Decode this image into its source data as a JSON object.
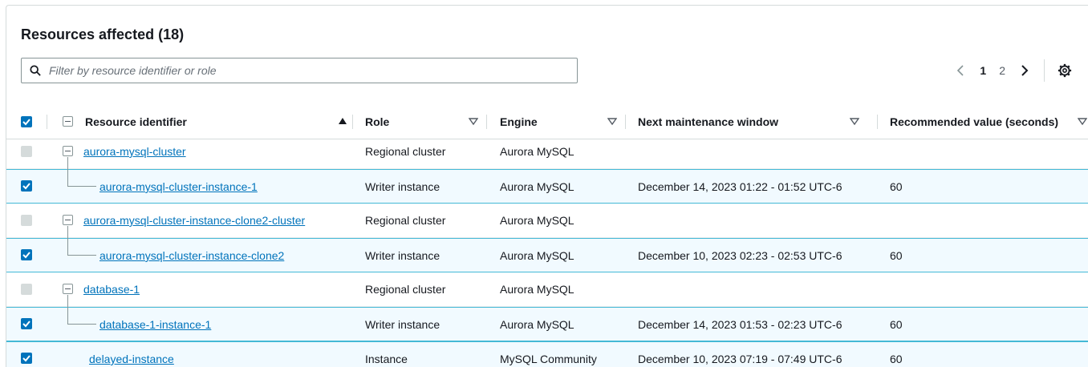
{
  "header": {
    "title": "Resources affected (18)"
  },
  "search": {
    "placeholder": "Filter by resource identifier or role",
    "value": ""
  },
  "pagination": {
    "pages": [
      "1",
      "2"
    ],
    "current_page": "1"
  },
  "columns": {
    "resource": "Resource identifier",
    "role": "Role",
    "engine": "Engine",
    "window": "Next maintenance window",
    "recommended": "Recommended value (seconds)"
  },
  "rows": [
    {
      "id": "aurora-mysql-cluster",
      "role": "Regional cluster",
      "engine": "Aurora MySQL",
      "window": "",
      "recommended": "",
      "checked": false,
      "disabled": true,
      "level": 0,
      "expandable": true
    },
    {
      "id": "aurora-mysql-cluster-instance-1",
      "role": "Writer instance",
      "engine": "Aurora MySQL",
      "window": "December 14, 2023 01:22 - 01:52 UTC-6",
      "recommended": "60",
      "checked": true,
      "disabled": false,
      "level": 1,
      "expandable": false
    },
    {
      "id": "aurora-mysql-cluster-instance-clone2-cluster",
      "role": "Regional cluster",
      "engine": "Aurora MySQL",
      "window": "",
      "recommended": "",
      "checked": false,
      "disabled": true,
      "level": 0,
      "expandable": true
    },
    {
      "id": "aurora-mysql-cluster-instance-clone2",
      "role": "Writer instance",
      "engine": "Aurora MySQL",
      "window": "December 10, 2023 02:23 - 02:53 UTC-6",
      "recommended": "60",
      "checked": true,
      "disabled": false,
      "level": 1,
      "expandable": false
    },
    {
      "id": "database-1",
      "role": "Regional cluster",
      "engine": "Aurora MySQL",
      "window": "",
      "recommended": "",
      "checked": false,
      "disabled": true,
      "level": 0,
      "expandable": true
    },
    {
      "id": "database-1-instance-1",
      "role": "Writer instance",
      "engine": "Aurora MySQL",
      "window": "December 14, 2023 01:53 - 02:23 UTC-6",
      "recommended": "60",
      "checked": true,
      "disabled": false,
      "level": 1,
      "expandable": false
    },
    {
      "id": "delayed-instance",
      "role": "Instance",
      "engine": "MySQL Community",
      "window": "December 10, 2023 07:19 - 07:49 UTC-6",
      "recommended": "60",
      "checked": true,
      "disabled": false,
      "level": 0,
      "expandable": false
    }
  ],
  "icons": {
    "search": "search-icon",
    "prev": "chevron-left-icon",
    "next": "chevron-right-icon",
    "settings": "gear-icon",
    "sort_asc": "sort-ascending-icon",
    "sort": "sort-icon",
    "check": "checkmark-icon"
  },
  "colors": {
    "link": "#0073bb",
    "checkbox": "#0073bb",
    "selected_row_bg": "#f1faff",
    "selected_row_border": "#44b9d6"
  }
}
